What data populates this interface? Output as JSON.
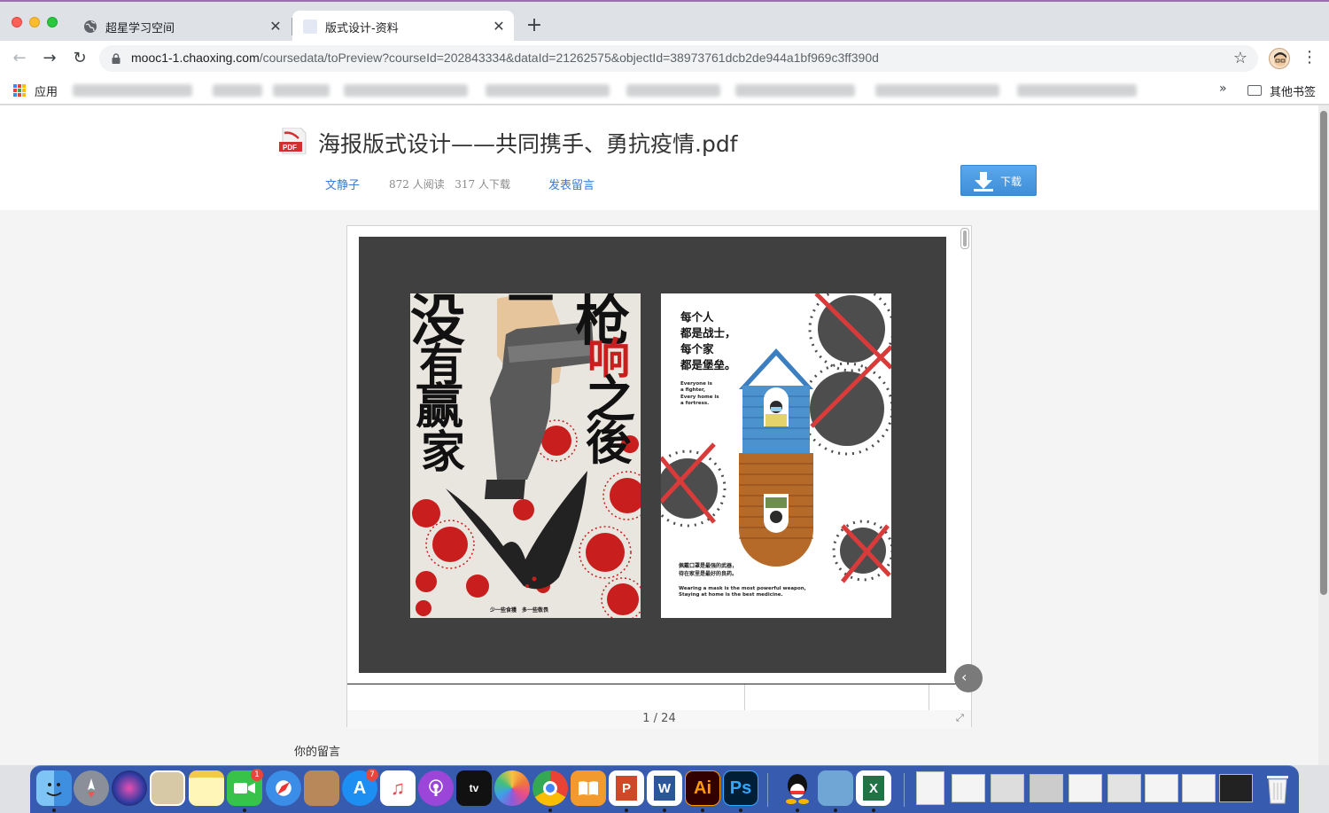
{
  "browser": {
    "tabs": [
      {
        "title": "超星学习空间",
        "close": "✕"
      },
      {
        "title": "版式设计-资料",
        "close": "✕"
      }
    ],
    "new_tab": "+",
    "url": {
      "host": "mooc1-1.chaoxing.com",
      "path": "/coursedata/toPreview?courseId=202843334&dataId=21262575&objectId=38973761dcb2de944a1bf969c3ff390d"
    },
    "nav": {
      "back": "←",
      "forward": "→",
      "reload": "↻"
    },
    "star": "☆",
    "menu": "⋮"
  },
  "bookmarks": {
    "apps_label": "应用",
    "overflow": "»",
    "other_label": "其他书签"
  },
  "document": {
    "title": "海报版式设计——共同携手、勇抗疫情.pdf",
    "author": "文静子",
    "reads": "872",
    "reads_label": "人阅读",
    "downloads": "317",
    "downloads_label": "人下载",
    "comment_link": "发表留言",
    "download_button": "下载",
    "page_indicator": "1 / 24",
    "your_comment": "你的留言"
  },
  "poster_left": {
    "chars_col_left": [
      "没",
      "有",
      "赢",
      "家"
    ],
    "chars_col_right": [
      "一",
      "枪",
      "响",
      "之",
      "後"
    ],
    "footer": "少一些食獲　多一些敬畏"
  },
  "poster_right": {
    "heading": [
      "每个人",
      "都是战士，",
      "每个家",
      "都是堡垒。"
    ],
    "en_heading": [
      "Everyone is",
      "a fighter,",
      "Every home is",
      "a fortress."
    ],
    "zh_footer": [
      "佩戴口罩是最强的武器，",
      "待在家里是最好的良药。"
    ],
    "en_footer": [
      "Wearing a mask is the most powerful weapon,",
      "Staying at home is the best medicine."
    ]
  },
  "dock": {
    "badges": {
      "facetime": "1",
      "appstore": "7"
    },
    "labels": {
      "ai": "Ai",
      "ps": "Ps",
      "word": "W",
      "ppt": "P",
      "excel": "X",
      "tv": "tv"
    }
  },
  "colors": {
    "link": "#3a7bd5",
    "download_button": "#4a9ae2",
    "viewer_bg": "#404040",
    "virus_red": "#c81e1e"
  }
}
